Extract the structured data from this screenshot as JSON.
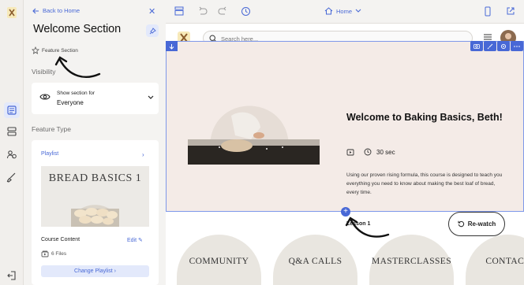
{
  "panel": {
    "back_label": "Back to Home",
    "title": "Welcome Section",
    "feature_tag": "Feature Section",
    "visibility_label": "Visibility",
    "visibility": {
      "caption": "Show section for",
      "value": "Everyone"
    },
    "feature_type_label": "Feature Type",
    "playlist": {
      "label": "Playlist",
      "thumb_title": "BREAD BASICS 1",
      "course_content_label": "Course Content",
      "edit_label": "Edit",
      "files": "6 Files",
      "change_button": "Change Playlist"
    }
  },
  "topbar": {
    "page_selector": "Home"
  },
  "site": {
    "search_placeholder": "Search here...",
    "hero": {
      "title": "Welcome to Baking Basics, Beth!",
      "duration": "30 sec",
      "description": "Using our proven rising formula, this course is designed to teach you everything you need to know about making the best loaf of bread, every time.",
      "lesson": "Lesson 1",
      "rewatch_button": "Re-watch"
    },
    "categories": [
      "COMMUNITY",
      "Q&A CALLS",
      "MASTERCLASSES",
      "CONTACT"
    ]
  },
  "colors": {
    "accent": "#4868d6",
    "hero_bg": "#f4ebe7",
    "panel_bg": "#f4f3f1"
  },
  "icons": [
    "logo-icon",
    "pages-icon",
    "layers-icon",
    "users-icon",
    "brush-icon",
    "exit-icon"
  ]
}
